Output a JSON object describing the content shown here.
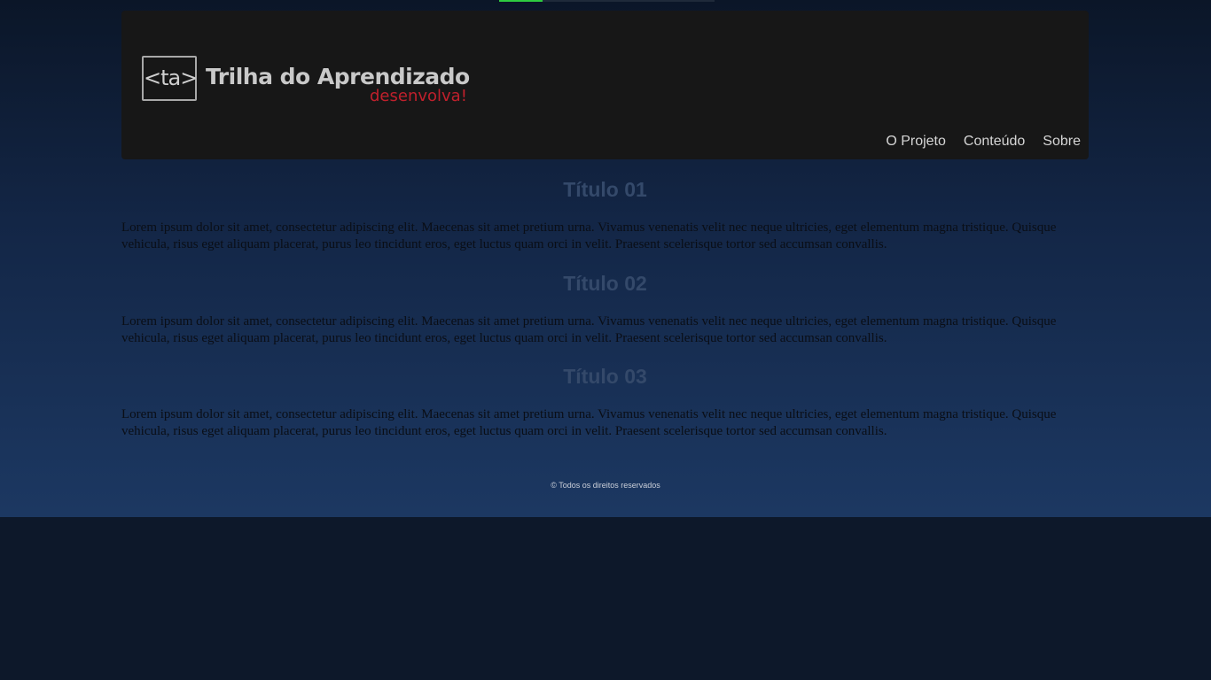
{
  "progress": {
    "value": 0.2
  },
  "header": {
    "logo": {
      "mark": "<ta>",
      "title": "Trilha do Aprendizado",
      "tagline": "desenvolva!"
    },
    "nav": [
      {
        "label": "O Projeto"
      },
      {
        "label": "Conteúdo"
      },
      {
        "label": "Sobre"
      }
    ]
  },
  "sections": [
    {
      "title": "Título 01",
      "text": "Lorem ipsum dolor sit amet, consectetur adipiscing elit. Maecenas sit amet pretium urna. Vivamus venenatis velit nec neque ultricies, eget elementum magna tristique. Quisque vehicula, risus eget aliquam placerat, purus leo tincidunt eros, eget luctus quam orci in velit. Praesent scelerisque tortor sed accumsan convallis."
    },
    {
      "title": "Título 02",
      "text": "Lorem ipsum dolor sit amet, consectetur adipiscing elit. Maecenas sit amet pretium urna. Vivamus venenatis velit nec neque ultricies, eget elementum magna tristique. Quisque vehicula, risus eget aliquam placerat, purus leo tincidunt eros, eget luctus quam orci in velit. Praesent scelerisque tortor sed accumsan convallis."
    },
    {
      "title": "Título 03",
      "text": "Lorem ipsum dolor sit amet, consectetur adipiscing elit. Maecenas sit amet pretium urna. Vivamus venenatis velit nec neque ultricies, eget elementum magna tristique. Quisque vehicula, risus eget aliquam placerat, purus leo tincidunt eros, eget luctus quam orci in velit. Praesent scelerisque tortor sed accumsan convallis."
    }
  ],
  "footer": {
    "text": "© Todos os direitos reservados"
  },
  "colors": {
    "header_bg": "#171717",
    "tagline": "#c0202c",
    "heading": "#34496a",
    "progress": "#2ecc40"
  }
}
